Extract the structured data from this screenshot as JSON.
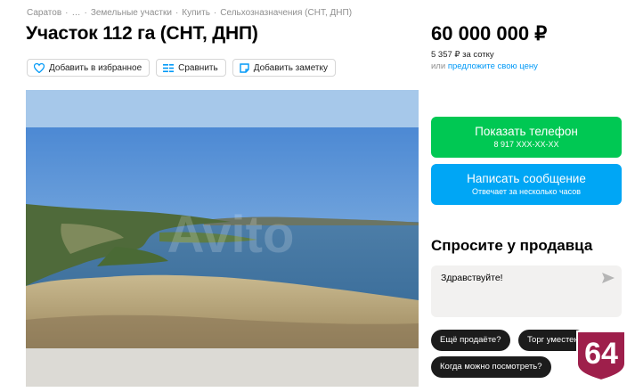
{
  "breadcrumb": [
    "Саратов",
    "…",
    "Земельные участки",
    "Купить",
    "Сельхозназначения (СНТ, ДНП)"
  ],
  "title": "Участок 112 га (СНТ, ДНП)",
  "actions": {
    "favorite": "Добавить в избранное",
    "compare": "Сравнить",
    "note": "Добавить заметку"
  },
  "price": {
    "value": "60 000 000 ₽",
    "per_unit": "5 357 ₽ за сотку",
    "offer_prefix": "или",
    "offer_link": "предложите свою цену"
  },
  "contact": {
    "phone_label": "Показать телефон",
    "phone_masked": "8 917 XXX-XX-XX",
    "message_label": "Написать сообщение",
    "message_sub": "Отвечает за несколько часов"
  },
  "ask": {
    "title": "Спросите у продавца",
    "message_text": "Здравствуйте!",
    "quick_questions": [
      "Ещё продаёте?",
      "Торг уместен?",
      "Когда можно посмотреть?"
    ]
  },
  "badge_number": "64",
  "colors": {
    "accent_green": "#00c853",
    "accent_blue": "#00a6f5",
    "link": "#0099f7",
    "badge": "#9e1f4b"
  }
}
